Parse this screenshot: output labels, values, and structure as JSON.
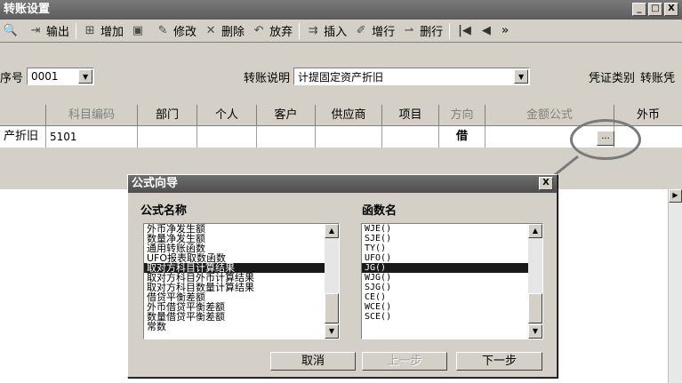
{
  "window": {
    "title": "转账设置",
    "minimize": "_",
    "maximize": "□",
    "close": "X"
  },
  "toolbar": {
    "items": [
      {
        "icon": "preview-icon",
        "label": ""
      },
      {
        "icon": "export-icon",
        "label": "输出"
      },
      {
        "icon": "add-icon",
        "label": "增加"
      },
      {
        "icon": "save-icon",
        "label": ""
      },
      {
        "icon": "edit-icon",
        "label": "修改"
      },
      {
        "icon": "delete-icon",
        "label": "删除"
      },
      {
        "icon": "undo-icon",
        "label": "放弃"
      },
      {
        "icon": "insert-icon",
        "label": "插入"
      },
      {
        "icon": "add-row-icon",
        "label": "增行"
      },
      {
        "icon": "delete-row-icon",
        "label": "删行"
      }
    ],
    "nav": [
      "|◀",
      "◀",
      "»"
    ]
  },
  "form": {
    "seq_label": "序号",
    "seq_value": "0001",
    "desc_label": "转账说明",
    "desc_value": "计提固定资产折旧",
    "voucher_label": "凭证类别",
    "voucher_value": "转账凭"
  },
  "grid": {
    "headers": [
      "",
      "科目编码",
      "部门",
      "个人",
      "客户",
      "供应商",
      "项目",
      "方向",
      "金额公式",
      "外币"
    ],
    "row": [
      "产折旧",
      "5101",
      "",
      "",
      "",
      "",
      "",
      "借",
      "",
      ""
    ],
    "cell_button": "..."
  },
  "dialog": {
    "title": "公式向导",
    "formula_label": "公式名称",
    "function_label": "函数名",
    "formula_items": [
      "外币净发生额",
      "数量净发生额",
      "通用转账函数",
      "UFO报表取数函数",
      "取对方科目计算结果",
      "取对方科目外币计算结果",
      "取对方科目数量计算结果",
      "借贷平衡差额",
      "外币借贷平衡差额",
      "数量借贷平衡差额",
      "常数"
    ],
    "formula_selected": 4,
    "function_items": [
      "WJE()",
      "SJE()",
      "TY()",
      "UFO()",
      "JG()",
      "WJG()",
      "SJG()",
      "CE()",
      "WCE()",
      "SCE()"
    ],
    "function_selected": 4,
    "buttons": {
      "cancel": "取消",
      "prev": "上一步",
      "next": "下一步"
    }
  },
  "colors": {
    "titlebar": "#6b6b6b",
    "selection": "#1a1a1a",
    "face": "#d4d0c8"
  }
}
